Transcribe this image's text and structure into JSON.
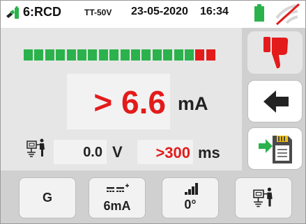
{
  "header": {
    "mode": "6:RCD",
    "range": "TT-50V",
    "date": "23-05-2020",
    "time": "16:34",
    "icons": [
      "probe-icon",
      "battery-icon",
      "wifi-off-icon"
    ],
    "battery_color": "#2bb24c",
    "wifi_slash_color": "#e31b1b"
  },
  "measurement": {
    "leakage_bar": {
      "segments": 18,
      "green_segments": 16,
      "red_segments": 2,
      "green_color": "#2bb24c",
      "red_color": "#e31b1b"
    },
    "current_value": "> 6.6",
    "current_unit": "mA",
    "voltage_value": "0.0",
    "voltage_unit": "V",
    "trip_time_value": ">300",
    "trip_time_unit": "ms",
    "value_color": "#e31b1b"
  },
  "side_buttons": {
    "result": {
      "icon": "thumbs-down-icon",
      "color": "#e31b1b"
    },
    "back": {
      "icon": "arrow-left-icon"
    },
    "save": {
      "icon": "save-to-memory-icon"
    }
  },
  "bottom_buttons": {
    "mode_label": "G",
    "current_label": "6mA",
    "angle_label": "0°",
    "icons": [
      "ac-dc-wave-icon",
      "phase-ramp-icon",
      "ground-person-icon"
    ]
  }
}
